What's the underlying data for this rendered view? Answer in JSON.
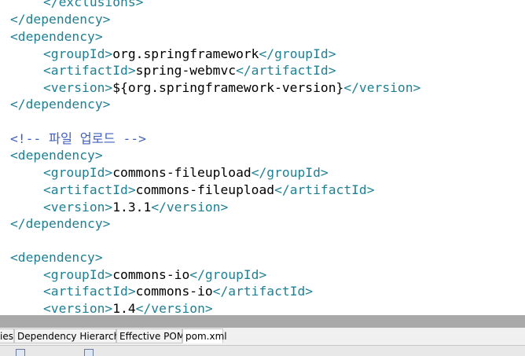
{
  "editor": {
    "lines": [
      {
        "tag_open": "</exclusions>"
      },
      {
        "tag_open": "</dependency>"
      },
      {
        "tag_open": "<dependency>"
      },
      {
        "tag_open": "<groupId>",
        "value": "org.springframework",
        "tag_close": "</groupId>"
      },
      {
        "tag_open": "<artifactId>",
        "value": "spring-webmvc",
        "tag_close": "</artifactId>"
      },
      {
        "tag_open": "<version>",
        "value": "${org.springframework-version}",
        "tag_close": "</version>"
      },
      {
        "tag_open": "</dependency>"
      },
      {
        "comment": "<!-- 파일 업로드 -->"
      },
      {
        "tag_open": "<dependency>"
      },
      {
        "tag_open": "<groupId>",
        "value": "commons-fileupload",
        "tag_close": "</groupId>"
      },
      {
        "tag_open": "<artifactId>",
        "value": "commons-fileupload",
        "tag_close": "</artifactId>"
      },
      {
        "tag_open": "<version>",
        "value": "1.3.1",
        "tag_close": "</version>"
      },
      {
        "tag_open": "</dependency>"
      },
      {
        "tag_open": "<dependency>"
      },
      {
        "tag_open": "<groupId>",
        "value": "commons-io",
        "tag_close": "</groupId>"
      },
      {
        "tag_open": "<artifactId>",
        "value": "commons-io",
        "tag_close": "</artifactId>"
      },
      {
        "tag_open": "<version>",
        "value": "1.4",
        "tag_close": "</version>"
      }
    ]
  },
  "tabs": [
    {
      "label": "ies"
    },
    {
      "label": "Dependency Hierarchy"
    },
    {
      "label": "Effective POM"
    },
    {
      "label": "pom.xml"
    }
  ],
  "colors": {
    "tag": "#1f7f93",
    "text": "#000000",
    "comment": "#3f5fbf",
    "divider": "#a9a9a9"
  }
}
